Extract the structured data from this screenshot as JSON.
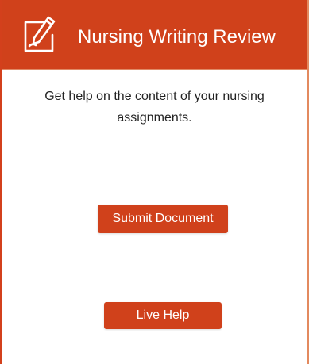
{
  "header": {
    "title": "Nursing Writing Review",
    "icon": "pencil-edit-icon",
    "background_color": "#d0411b"
  },
  "main": {
    "description": "Get help on the content of your nursing assignments."
  },
  "actions": {
    "submit_label": "Submit Document",
    "live_help_label": "Live Help",
    "button_color": "#d0411b"
  }
}
